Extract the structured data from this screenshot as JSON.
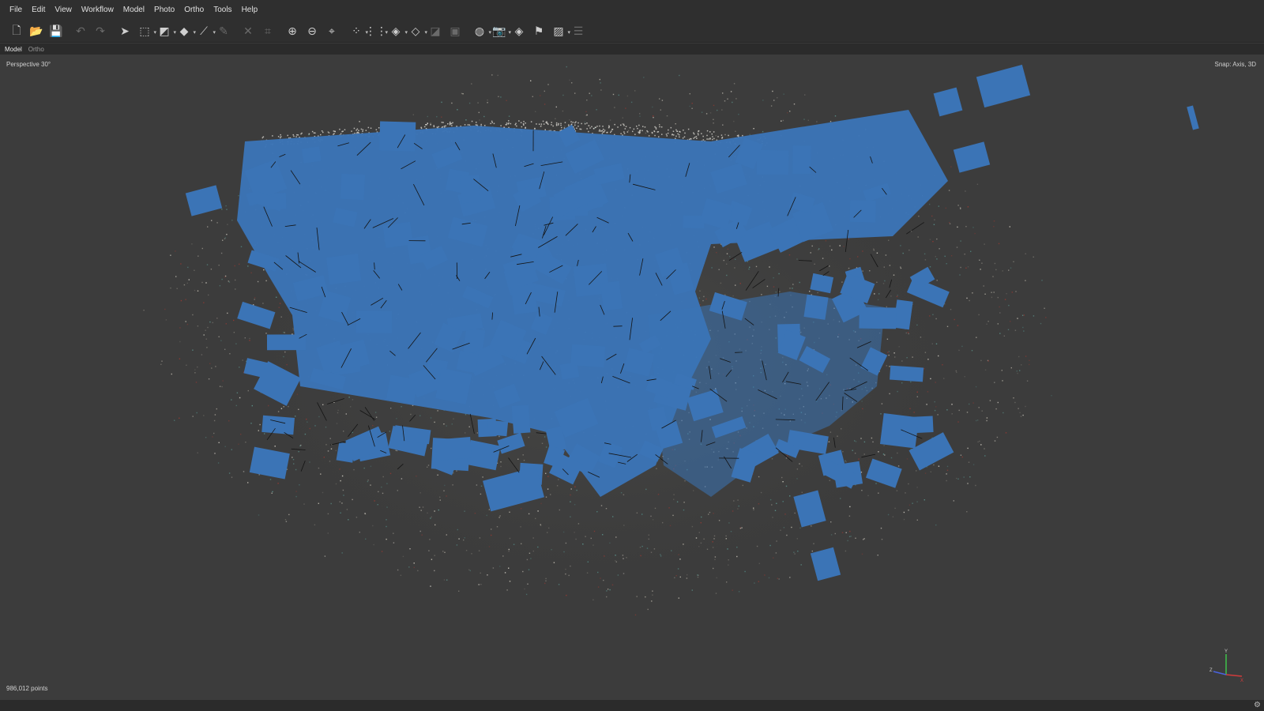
{
  "menu": [
    "File",
    "Edit",
    "View",
    "Workflow",
    "Model",
    "Photo",
    "Ortho",
    "Tools",
    "Help"
  ],
  "toolbar": [
    {
      "name": "new-icon",
      "glyph": "🗋"
    },
    {
      "name": "open-icon",
      "glyph": "📂"
    },
    {
      "name": "save-icon",
      "glyph": "💾"
    },
    {
      "sep": true
    },
    {
      "name": "undo-icon",
      "glyph": "↶",
      "disabled": true
    },
    {
      "name": "redo-icon",
      "glyph": "↷",
      "disabled": true
    },
    {
      "sep": true
    },
    {
      "name": "navigation-icon",
      "glyph": "➤"
    },
    {
      "name": "rectangle-selection-icon",
      "glyph": "⬚",
      "caret": true
    },
    {
      "name": "resize-region-icon",
      "glyph": "◩",
      "caret": true
    },
    {
      "name": "rotate-object-icon",
      "glyph": "◆",
      "caret": true
    },
    {
      "name": "draw-polyline-icon",
      "glyph": "⟋",
      "caret": true
    },
    {
      "name": "ruler-icon",
      "glyph": "✎",
      "disabled": true
    },
    {
      "sep": true
    },
    {
      "name": "delete-selection-icon",
      "glyph": "✕",
      "disabled": true
    },
    {
      "name": "crop-selection-icon",
      "glyph": "⌗",
      "disabled": true
    },
    {
      "sep": true
    },
    {
      "name": "zoom-in-icon",
      "glyph": "⊕"
    },
    {
      "name": "zoom-out-icon",
      "glyph": "⊖"
    },
    {
      "name": "reset-view-icon",
      "glyph": "⌖"
    },
    {
      "sep": true
    },
    {
      "name": "show-cameras-icon",
      "glyph": "⁘",
      "caret": true
    },
    {
      "name": "show-points-icon",
      "glyph": "⋮⋮",
      "caret": true
    },
    {
      "name": "model-view-icon",
      "glyph": "◈",
      "caret": true
    },
    {
      "name": "shaded-view-icon",
      "glyph": "◇",
      "caret": true
    },
    {
      "name": "textured-icon",
      "glyph": "◪",
      "disabled": true
    },
    {
      "name": "dem-icon",
      "glyph": "▣",
      "disabled": true
    },
    {
      "sep": true
    },
    {
      "name": "show-region-icon",
      "glyph": "◍",
      "caret": true
    },
    {
      "name": "camera-icon",
      "glyph": "📷",
      "caret": true
    },
    {
      "name": "shape-icon",
      "glyph": "◈"
    },
    {
      "name": "marker-flag-icon",
      "glyph": "⚑"
    },
    {
      "name": "image-icon",
      "glyph": "▨",
      "caret": true
    },
    {
      "name": "layers-icon",
      "glyph": "☰",
      "disabled": true
    }
  ],
  "tabs": [
    {
      "label": "Model",
      "active": true
    },
    {
      "label": "Ortho",
      "active": false
    }
  ],
  "viewport": {
    "view_mode": "Perspective 30°",
    "snap_mode": "Snap: Axis, 3D",
    "points_count": "986,012 points"
  },
  "colors": {
    "camera_plane": "#3b74b6",
    "background": "#3c3c3c"
  }
}
